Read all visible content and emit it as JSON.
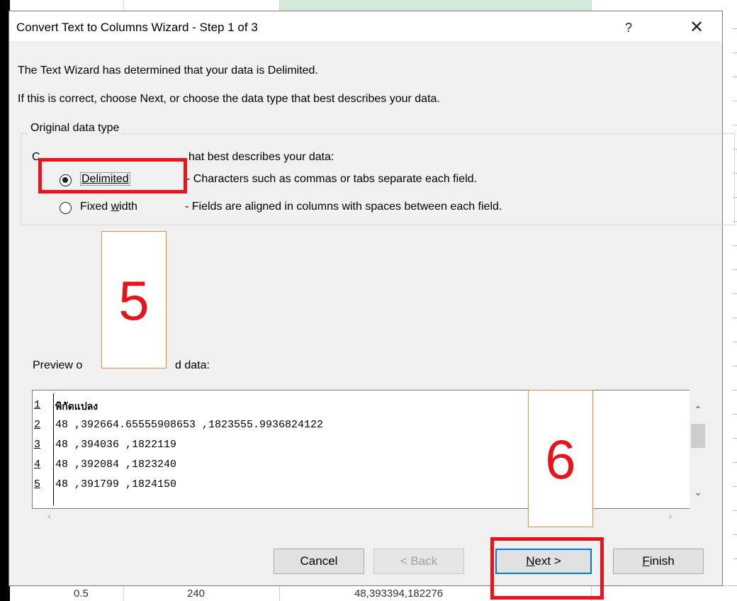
{
  "dialog": {
    "title": "Convert Text to Columns Wizard - Step 1 of 3",
    "help_label": "?",
    "close_label": "✕",
    "line1": "The Text Wizard has determined that your data is Delimited.",
    "line2": "If this is correct, choose Next, or choose the data type that best describes your data.",
    "group_label": "Original data type",
    "choose_prefix": "C",
    "choose_suffix": "hat best describes your data:",
    "options": [
      {
        "label": "Delimited",
        "description": "- Characters such as commas or tabs separate each field.",
        "selected": true
      },
      {
        "label_pre": "Fixed ",
        "label_u": "w",
        "label_post": "idth",
        "description": "- Fields are aligned in columns with spaces between each field.",
        "selected": false
      }
    ],
    "preview_prefix": "Preview o",
    "preview_suffix": "d data:",
    "preview_rows": [
      {
        "n": "1",
        "text": "พิกัดแปลง"
      },
      {
        "n": "2",
        "text": "48 ,392664.65555908653 ,1823555.9936824122"
      },
      {
        "n": "3",
        "text": "48 ,394036 ,1822119"
      },
      {
        "n": "4",
        "text": "48 ,392084 ,1823240"
      },
      {
        "n": "5",
        "text": "48 ,391799 ,1824150"
      }
    ],
    "buttons": {
      "cancel": "Cancel",
      "back": "< Back",
      "next_u": "N",
      "next_rest": "ext >",
      "finish_u": "F",
      "finish_rest": "inish"
    }
  },
  "annotations": {
    "step5": "5",
    "step6": "6"
  },
  "sheet_bottom": {
    "a": "0.5",
    "b": "240",
    "c": "48,393394,182276"
  },
  "colors": {
    "highlight_red": "#e8141c",
    "callout_border": "#f08c3c",
    "default_button_border": "#0078d7"
  }
}
